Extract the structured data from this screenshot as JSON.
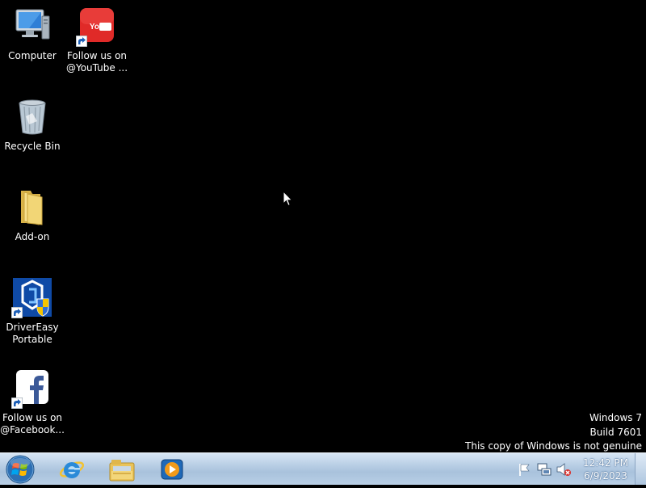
{
  "desktop": {
    "icons": [
      {
        "label": "Computer",
        "icon": "computer-icon",
        "shortcut": false
      },
      {
        "label": "Follow us on\n@YouTube ...",
        "icon": "youtube-icon",
        "shortcut": true
      },
      {
        "label": "Recycle Bin",
        "icon": "recycle-bin-icon",
        "shortcut": false
      },
      {
        "label": "Add-on",
        "icon": "folder-icon",
        "shortcut": false
      },
      {
        "label": "DriverEasy\nPortable",
        "icon": "drivereasy-icon",
        "shortcut": true
      },
      {
        "label": "Follow us on\n@Facebook...",
        "icon": "facebook-icon",
        "shortcut": true
      }
    ],
    "watermark": {
      "line1": "Windows 7",
      "line2": "Build 7601",
      "line3": "This copy of Windows is not genuine"
    }
  },
  "taskbar": {
    "start_button": "windows-orb-icon",
    "pinned_apps": [
      {
        "icon": "internet-explorer-icon"
      },
      {
        "icon": "windows-explorer-icon"
      },
      {
        "icon": "media-player-icon"
      }
    ],
    "tray": {
      "icons": [
        "action-center-flag-icon",
        "network-icon",
        "volume-muted-icon"
      ],
      "time": "12:42 PM",
      "date": "6/9/2023"
    }
  },
  "colors": {
    "desktop_background": "#000000",
    "taskbar_top": "#d7e6f5",
    "taskbar_bottom": "#a9c2dc",
    "youtube_red": "#e02a28",
    "facebook_blue": "#3b5998"
  }
}
